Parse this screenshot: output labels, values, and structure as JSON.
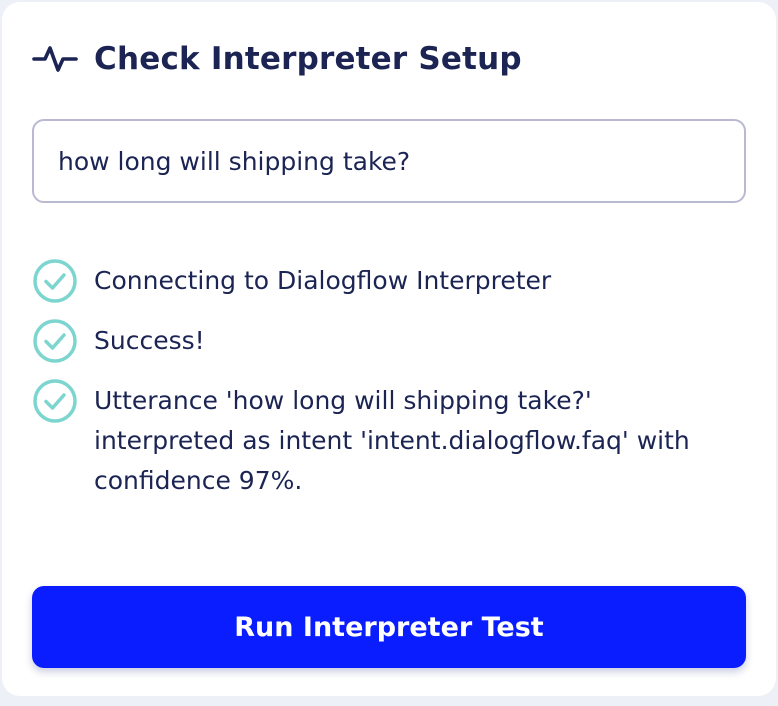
{
  "panel": {
    "title": "Check Interpreter Setup",
    "header_icon": "activity-pulse-icon"
  },
  "utterance_input": {
    "value": "how long will shipping take?",
    "placeholder": ""
  },
  "steps": [
    {
      "status": "success",
      "icon": "check-circle-icon",
      "text": "Connecting to Dialogflow Interpreter"
    },
    {
      "status": "success",
      "icon": "check-circle-icon",
      "text": "Success!"
    },
    {
      "status": "success",
      "icon": "check-circle-icon",
      "text": "Utterance 'how long will shipping take?'\ninterpreted as intent 'intent.dialogflow.faq' with\nconfidence 97%."
    }
  ],
  "run_button": {
    "label": "Run Interpreter Test"
  },
  "colors": {
    "text": "#1b2453",
    "accent_button": "#0a1dff",
    "success_check": "#7dd5cf",
    "input_border": "#b9bad2",
    "page_background": "#eef0f8"
  }
}
